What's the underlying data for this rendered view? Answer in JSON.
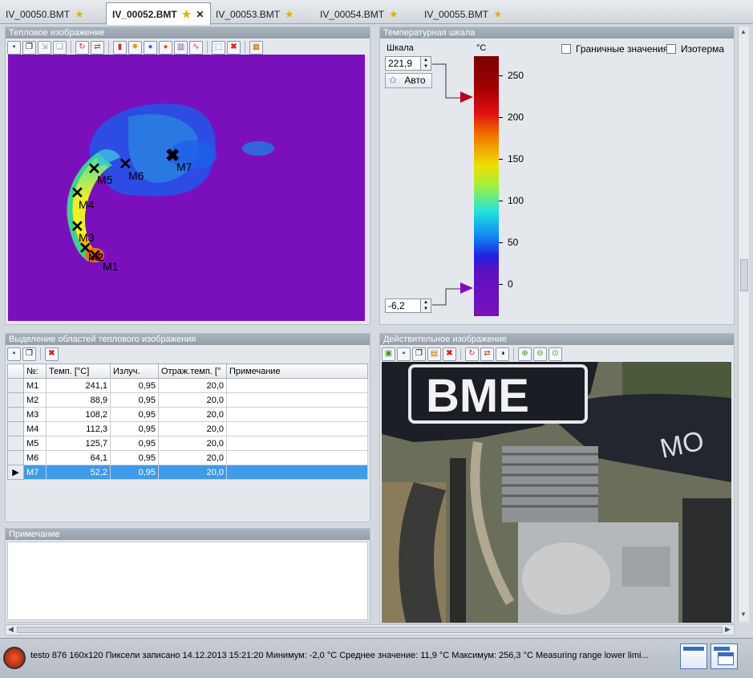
{
  "tabs": [
    {
      "label": "IV_00050.BMT",
      "active": false
    },
    {
      "label": "IV_00052.BMT",
      "active": true
    },
    {
      "label": "IV_00053.BMT",
      "active": false
    },
    {
      "label": "IV_00054.BMT",
      "active": false
    },
    {
      "label": "IV_00055.BMT",
      "active": false
    }
  ],
  "thermal_panel": {
    "title": "Тепловое изображение",
    "markers": [
      "M1",
      "M2",
      "M3",
      "M4",
      "M5",
      "M6",
      "M7"
    ]
  },
  "scale_panel": {
    "title": "Температурная шкала",
    "scale_label": "Шкала",
    "max_value": "221,9",
    "min_value": "-6,2",
    "auto_label": "Авто",
    "unit": "°C",
    "boundary_label": "Граничные значения",
    "isotherm_label": "Изотерма",
    "ticks": [
      "250",
      "200",
      "150",
      "100",
      "50",
      "0"
    ]
  },
  "regions_panel": {
    "title": "Выделение областей теплового изображения",
    "columns": [
      "№:",
      "Темп. [°C]",
      "Излуч.",
      "Отраж.темп. [°",
      "Примечание"
    ],
    "rows": [
      {
        "id": "M1",
        "temp": "241,1",
        "emis": "0,95",
        "refl": "20,0",
        "note": ""
      },
      {
        "id": "M2",
        "temp": "88,9",
        "emis": "0,95",
        "refl": "20,0",
        "note": ""
      },
      {
        "id": "M3",
        "temp": "108,2",
        "emis": "0,95",
        "refl": "20,0",
        "note": ""
      },
      {
        "id": "M4",
        "temp": "112,3",
        "emis": "0,95",
        "refl": "20,0",
        "note": ""
      },
      {
        "id": "M5",
        "temp": "125,7",
        "emis": "0,95",
        "refl": "20,0",
        "note": ""
      },
      {
        "id": "M6",
        "temp": "64,1",
        "emis": "0,95",
        "refl": "20,0",
        "note": ""
      },
      {
        "id": "M7",
        "temp": "52,2",
        "emis": "0,95",
        "refl": "20,0",
        "note": ""
      }
    ],
    "selected_row": "M7"
  },
  "note_panel": {
    "title": "Примечание"
  },
  "photo_panel": {
    "title": "Действительное изображение",
    "photo_text": "BME"
  },
  "status": {
    "text": "testo  876 160x120 Пиксели записано 14.12.2013  15:21:20  Минимум: -2,0 °C  Среднее значение: 11,9 °C  Максимум: 256,3 °C  Measuring range lower limi..."
  },
  "colors": {
    "background_purple": "#7a10bb",
    "selection_blue": "#3d9bea",
    "scale_max_marker": "#b8001e",
    "scale_min_marker": "#8a00c8"
  }
}
